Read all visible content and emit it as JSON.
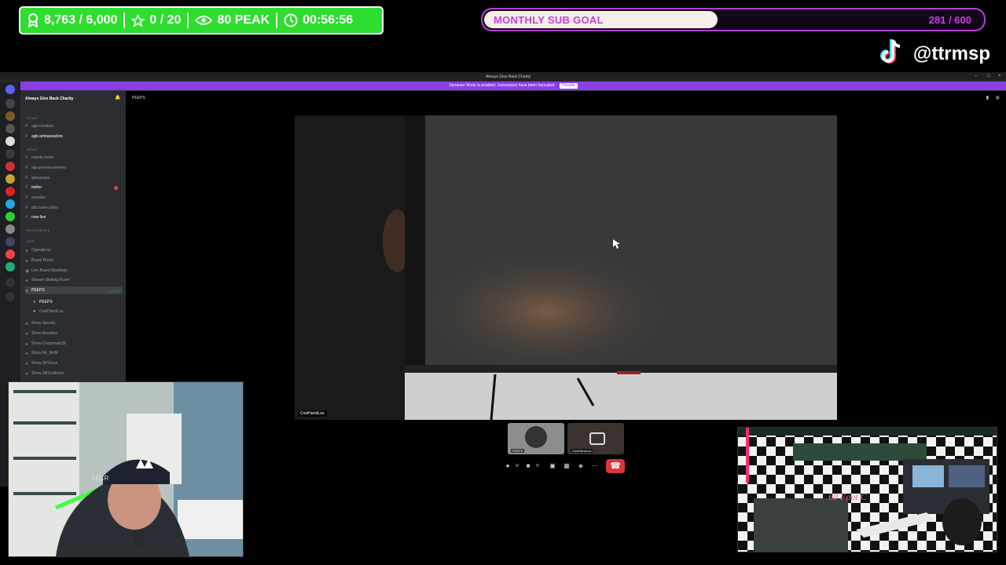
{
  "overlay": {
    "followers": "8,763 / 6,000",
    "stars": "0 / 20",
    "peak": "80 PEAK",
    "timer": "00:56:56",
    "sub_goal": {
      "label": "MONTHLY SUB GOAL",
      "count": "281 / 600",
      "progress": 0.468
    },
    "tiktok_handle": "@ttrmsp"
  },
  "discord": {
    "window_title": "Always Give Back Charity",
    "banner_text": "Streamer Mode is enabled. Usernames have been truncated.",
    "banner_button": "Disable",
    "server_name": "Always Give Back Charity",
    "current_channel": "PEEPS",
    "categories": {
      "staff": "STAFF",
      "news": "NEWS",
      "resources": "RESOURCES",
      "ops": "OPS"
    },
    "channels": {
      "agb_creators": "agb-creators",
      "agb_ambassadors": "agb-ambassadors",
      "charity_news": "charity-news",
      "alg_announcements": "alg-announcements",
      "giveaways": "giveaways",
      "twitter": "twitter",
      "youtube": "youtube",
      "discount_codes": "discount-codes",
      "now_live": "now-live",
      "operations": "Operations",
      "board_room": "Board Room",
      "live_board_meetings": "Live Board Meetings",
      "stream_waiting_room": "Stream Waiting Room",
      "peeps": "PEEPS",
      "peeps_time": "1:41:34",
      "peeps_member1": "PEEPS",
      "peeps_member2": "CoolHandLou",
      "show_spooky": "Show Spooky",
      "show_bearded": "Show Bearded",
      "show_crazymate": "Show Crazymate28",
      "show_mr_mnm": "Show Mr_MnM",
      "show_spcicon": "Show SPCicon",
      "show_sbgodkoko": "Show SBGodKoko"
    },
    "video_label": "CoolHandLou",
    "participants": [
      "PEEPS",
      "CoolHandLou"
    ]
  }
}
